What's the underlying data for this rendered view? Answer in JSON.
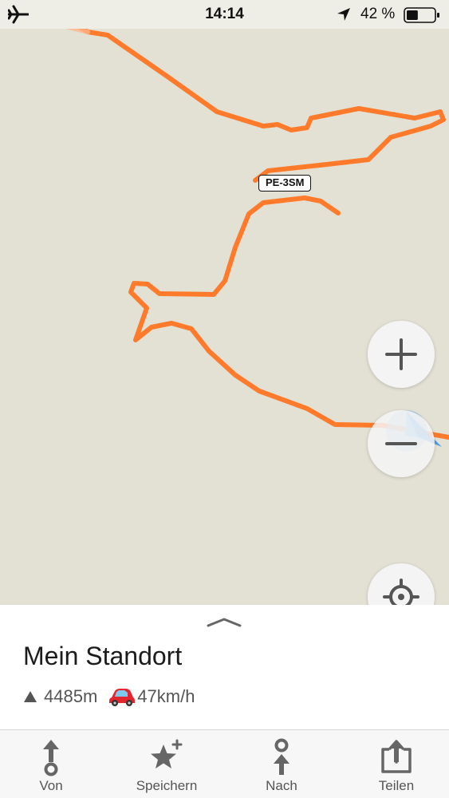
{
  "status_bar": {
    "time": "14:14",
    "battery_percent": "42 %",
    "battery_level": 0.42,
    "icons": [
      "airplane-icon",
      "location-arrow-icon",
      "battery-icon"
    ]
  },
  "map": {
    "road_label": "PE-3SM",
    "route_color": "#ff7a2a",
    "background_color": "#e3e1d4",
    "buttons": {
      "zoom_in": "plus-icon",
      "zoom_out": "minus-icon",
      "locate": "crosshair-icon"
    }
  },
  "sheet": {
    "title": "Mein Standort",
    "altitude": "4485m",
    "speed": "47km/h"
  },
  "tabbar": {
    "from": "Von",
    "save": "Speichern",
    "to": "Nach",
    "share": "Teilen"
  }
}
